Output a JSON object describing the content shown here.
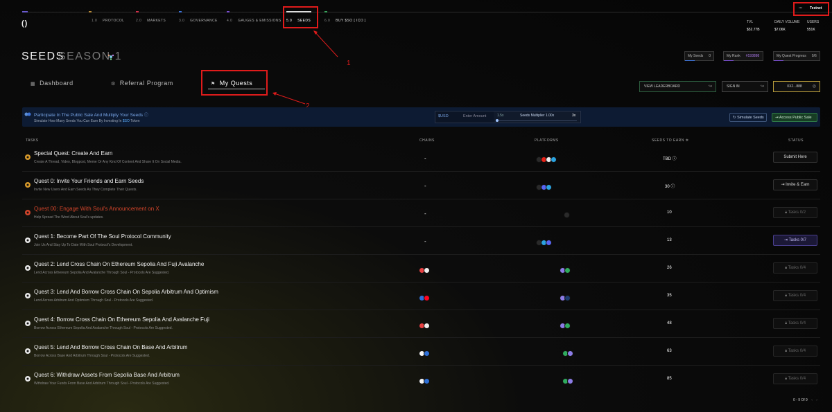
{
  "nav": {
    "logo": "()",
    "items": [
      {
        "num": "1.0",
        "label": "PROTOCOL"
      },
      {
        "num": "2.0",
        "label": "MARKETS"
      },
      {
        "num": "3.0",
        "label": "GOVERNANCE"
      },
      {
        "num": "4.0",
        "label": "GAUGES & EMISSIONS"
      },
      {
        "num": "5.0",
        "label": "SEEDS"
      },
      {
        "num": "6.0",
        "label": "BUY $SO [ ICO ]"
      }
    ],
    "testnet": "Testnet",
    "testnet_dots": "•••",
    "stats": [
      {
        "label": "TVL",
        "value": "$52.77B"
      },
      {
        "label": "DAILY VOLUME",
        "value": "$7.06K"
      },
      {
        "label": "USERS",
        "value": "551K"
      }
    ]
  },
  "header": {
    "title": "SEEDS",
    "season": "SEASON 1",
    "pills": [
      {
        "label": "My Seeds",
        "value": "0"
      },
      {
        "label": "My Rank",
        "value": "#193898"
      },
      {
        "label": "My Quest Progress",
        "value": "0/6"
      }
    ]
  },
  "tabs": [
    {
      "label": "Dashboard",
      "icon": "grid-icon"
    },
    {
      "label": "Referral Program",
      "icon": "gear-icon"
    },
    {
      "label": "My Quests",
      "icon": "flag-icon"
    }
  ],
  "actions": {
    "leaderboard": "VIEW LEADERBOARD",
    "signin": "SIGN IN",
    "wallet": "0X2...888"
  },
  "annotations": [
    "1",
    "2"
  ],
  "banner": {
    "title": "Participate In The Public Sale And Multiply Your Seeds",
    "subtitle_pre": "Simulate How Many Seeds You Can Earn By Investing In",
    "subtitle_token": "$SO",
    "subtitle_post": "Token",
    "currency": "$USD",
    "amount_placeholder": "Enter Amount",
    "mult_min": "1.5x",
    "mult_label": "Seeds Multiplier 1.00x",
    "mult_max": "3x",
    "simulate": "Simulate Seeds",
    "access": "Access Public Sale"
  },
  "table": {
    "headers": {
      "tasks": "TASKS",
      "chains": "CHAINS",
      "platforms": "PLATFORMS",
      "seeds": "SEEDS TO EARN",
      "status": "STATUS"
    },
    "rows": [
      {
        "title": "Special Quest: Create And Earn",
        "desc": "Create A Thread, Video, Blogpost, Meme Or Any Kind Of Content And Share It On Social Media.",
        "chains": "-",
        "seeds": "TBD",
        "status": "Submit Here"
      },
      {
        "title": "Quest 0: Invite Your Friends and Earn Seeds",
        "desc": "Invite New Users And Earn Seeds As They Complete Their Quests.",
        "chains": "-",
        "seeds": "30",
        "status": "Invite & Earn"
      },
      {
        "title": "Quest 00: Engage With Soul's Announcement on X",
        "desc": "Help Spread The Word About Soul's updates.",
        "chains": "-",
        "seeds": "10",
        "status": "Tasks 0/2"
      },
      {
        "title": "Quest 1: Become Part Of The Soul Protocol Community",
        "desc": "Join Us And Stay Up To Date With Soul Protocol's Development.",
        "chains": "-",
        "seeds": "13",
        "status": "Tasks 0/7"
      },
      {
        "title": "Quest 2: Lend Cross Chain On Ethereum Sepolia And Fuji Avalanche",
        "desc": "Lend Across Ethereum Sepolia And Avalanche Through Soul - Protocols Are Suggested.",
        "chains": "",
        "seeds": "26",
        "status": "Tasks 0/4"
      },
      {
        "title": "Quest 3: Lend And Borrow Cross Chain On Sepolia Arbitrum And Optimism",
        "desc": "Lend Across Arbitrum And Optimism Through Soul - Protocols Are Suggested.",
        "chains": "",
        "seeds": "35",
        "status": "Tasks 0/4"
      },
      {
        "title": "Quest 4: Borrow Cross Chain On Ethereum Sepolia And Avalanche Fuji",
        "desc": "Borrow Across Ethereum Sepolia And Avalanche Through Soul - Protocols Are Suggested.",
        "chains": "",
        "seeds": "48",
        "status": "Tasks 0/4"
      },
      {
        "title": "Quest 5: Lend And Borrow Cross Chain On Base And Arbitrum",
        "desc": "Borrow Across Base And Arbitrum Through Soul - Protocols Are Suggested.",
        "chains": "",
        "seeds": "63",
        "status": "Tasks 0/4"
      },
      {
        "title": "Quest 6: Withdraw Assets From Sepolia Base And Arbitrum",
        "desc": "Withdraw Your Funds From Base And Arbitrum Through Soul - Protocols Are Suggested.",
        "chains": "",
        "seeds": "85",
        "status": "Tasks 0/4"
      }
    ]
  },
  "pagination": {
    "text": "0 - 9 Of 9",
    "prev": "‹",
    "next": "›"
  },
  "colors": {
    "accent_red": "#e01b1b",
    "quest_red": "#d4452b",
    "purple": "#4a3f8f",
    "green": "#2f7a48",
    "banner_bg": "#0d1b33"
  }
}
